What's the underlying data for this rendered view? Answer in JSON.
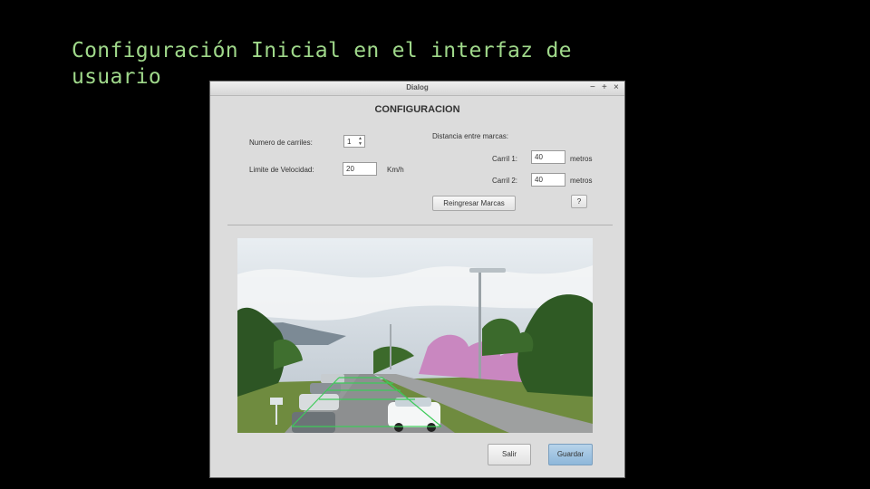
{
  "slide": {
    "title_line1": "Configuración Inicial en el interfaz de",
    "title_line2": "usuario"
  },
  "dialog": {
    "window_title": "Dialog",
    "controls": {
      "minimize": "−",
      "maximize": "+",
      "close": "×"
    },
    "heading": "CONFIGURACION",
    "lanes": {
      "label": "Numero de carriles:",
      "value": "1"
    },
    "speed": {
      "label": "Limite de Velocidad:",
      "value": "20",
      "unit": "Km/h"
    },
    "distance": {
      "label": "Distancia entre marcas:",
      "lane1": {
        "label": "Carril 1:",
        "value": "40",
        "unit": "metros"
      },
      "lane2": {
        "label": "Carril 2:",
        "value": "40",
        "unit": "metros"
      }
    },
    "reenter_button": "Reingresar Marcas",
    "help_button": "?",
    "exit_button": "Salir",
    "save_button": "Guardar"
  },
  "colors": {
    "title_text": "#9fd88a",
    "primary_button": "#9fc2e0",
    "marker_lines": "#3ecb5a"
  }
}
